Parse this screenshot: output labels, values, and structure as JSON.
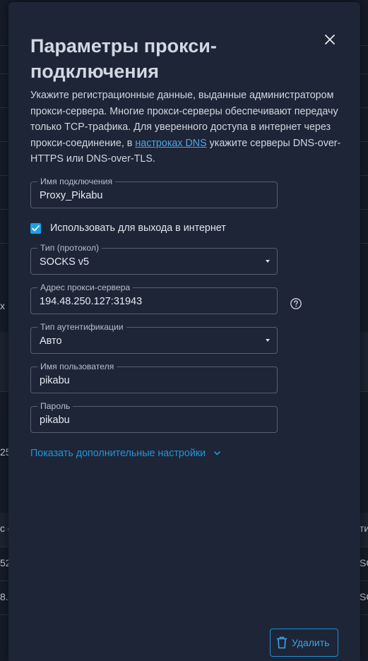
{
  "background": {
    "fragments": [
      "x .",
      "25.",
      "с с",
      "52",
      "8.:",
      "ти",
      "SO",
      "SO"
    ]
  },
  "dialog": {
    "title": "Параметры прокси-подключения",
    "description": {
      "before": "Укажите регистрационные данные, выданные администратором прокси-сервера. Многие прокси-серверы обеспечивают передачу только TCP-трафика. Для уверенного доступа в интернет через прокси-соединение, в ",
      "link": "настроках DNS",
      "after": " укажите серверы DNS-over-HTTPS или DNS-over-TLS."
    },
    "connection_name": {
      "label": "Имя подключения",
      "value": "Proxy_Pikabu"
    },
    "use_for_internet": {
      "label": "Использовать для выхода в интернет",
      "checked": true
    },
    "protocol": {
      "label": "Тип (протокол)",
      "value": "SOCKS v5"
    },
    "server_address": {
      "label": "Адрес прокси-сервера",
      "value": "194.48.250.127:31943"
    },
    "auth_type": {
      "label": "Тип аутентификации",
      "value": "Авто"
    },
    "username": {
      "label": "Имя пользователя",
      "value": "pikabu"
    },
    "password": {
      "label": "Пароль",
      "value": "pikabu"
    },
    "advanced_link": "Показать дополнительные настройки",
    "delete_button": "Удалить",
    "icons": {
      "close": "close-icon",
      "check": "checkmark-icon",
      "help": "question-circle-icon",
      "chevron": "chevron-down-icon",
      "trash": "trash-icon"
    },
    "colors": {
      "accent": "#1aa1e8",
      "link": "#4aa8ea",
      "panel": "#1e2536"
    }
  }
}
